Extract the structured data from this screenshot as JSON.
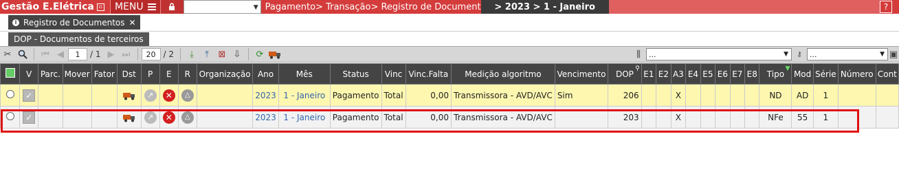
{
  "topbar": {
    "app_title": "Gestão E.Elétrica",
    "menu_label": "MENU",
    "breadcrumb": "Pagamento> Transação> Registro de Documentos>",
    "period": "> 2023 > 1 - Janeiro",
    "help_label": "?"
  },
  "tabs": {
    "main_tab": "Registro de Documentos",
    "sub_tab": "DOP - Documentos de terceiros"
  },
  "pager": {
    "current_page": "1",
    "total_pages": "/ 1",
    "page_size": "20",
    "size_total": "/ 2"
  },
  "filters": {
    "filter1_value": "...",
    "filter2_value": "..."
  },
  "table": {
    "headers": [
      "V",
      "Parc.",
      "Mover",
      "Fator",
      "Dst",
      "P",
      "E",
      "R",
      "Organização",
      "Ano",
      "Mês",
      "Status",
      "Vinc",
      "Vinc.Falta",
      "Medição algoritmo",
      "Vencimento",
      "DOP",
      "E1",
      "E2",
      "A3",
      "E4",
      "E5",
      "E6",
      "E7",
      "E8",
      "Tipo",
      "Mod",
      "Série",
      "Número",
      "Cont"
    ],
    "rows": [
      {
        "ano": "2023",
        "mes": "1 - Janeiro",
        "status": "Pagamento",
        "vinc": "Total",
        "vinc_falta": "0,00",
        "medicao": "Transmissora - AVD/AVC",
        "vencimento": "Sim",
        "dop": "206",
        "a3": "X",
        "tipo": "ND",
        "mod": "AD",
        "serie": "1",
        "numero": ""
      },
      {
        "ano": "2023",
        "mes": "1 - Janeiro",
        "status": "Pagamento",
        "vinc": "Total",
        "vinc_falta": "0,00",
        "medicao": "Transmissora - AVD/AVC",
        "vencimento": "",
        "dop": "203",
        "a3": "X",
        "tipo": "NFe",
        "mod": "55",
        "serie": "1",
        "numero": ""
      }
    ]
  },
  "colors": {
    "brand_red": "#d43c3c",
    "row_highlight": "#fdf7b0",
    "selection_border": "#e01010"
  }
}
